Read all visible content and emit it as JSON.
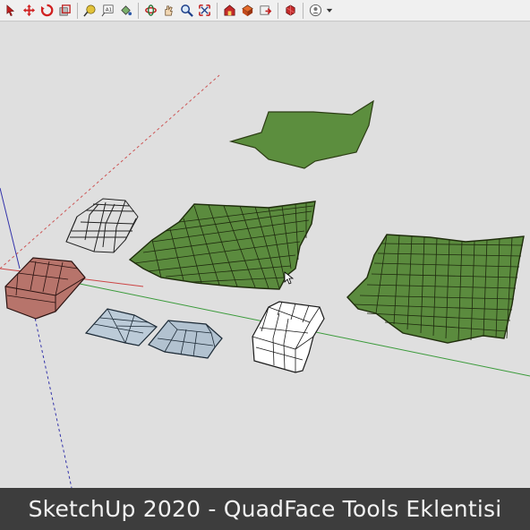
{
  "caption": {
    "text": "SketchUp 2020 - QuadFace Tools Eklentisi"
  },
  "toolbar": {
    "groups": [
      [
        "select-tool-icon",
        "move-tool-icon",
        "rotate-tool-icon",
        "scale-tool-icon"
      ],
      [
        "tape-measure-icon",
        "text-tool-icon",
        "paint-bucket-icon"
      ],
      [
        "orbit-tool-icon",
        "pan-tool-icon",
        "zoom-tool-icon",
        "zoom-extents-icon"
      ],
      [
        "warehouse-icon",
        "components-icon",
        "share-model-icon"
      ],
      [
        "extension-warehouse-icon"
      ],
      [
        "account-icon"
      ]
    ]
  },
  "colors": {
    "surface_green": "#5a8c3c",
    "surface_dark_edge": "#23330f",
    "red_box": "#b8736a",
    "white_box": "#ffffff",
    "blue_shapes": "#b8c8d6",
    "axis_red": "#c55",
    "axis_green": "#3a9a3a",
    "axis_blue": "#3333aa"
  }
}
